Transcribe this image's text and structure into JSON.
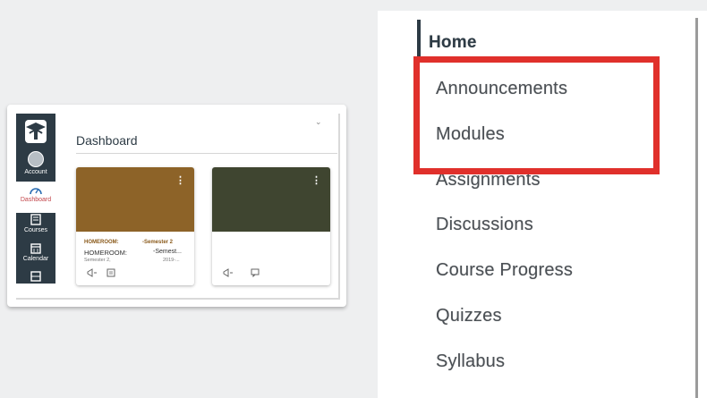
{
  "dashboard": {
    "title": "Dashboard",
    "global_nav": [
      {
        "label": "Account",
        "icon": "account-avatar-icon"
      },
      {
        "label": "Dashboard",
        "icon": "dashboard-speedometer-icon",
        "active": true
      },
      {
        "label": "Courses",
        "icon": "courses-book-icon"
      },
      {
        "label": "Calendar",
        "icon": "calendar-icon"
      },
      {
        "label": "",
        "icon": "inbox-icon"
      }
    ],
    "cards": [
      {
        "color": "#8d6328",
        "code": "HOMEROOM:",
        "term": "-Semester 2",
        "name": "HOMEROOM:",
        "name_right": "-Semest...",
        "sub": "Semester 2,",
        "sub_right": "2019-..."
      },
      {
        "color": "#3f4530",
        "code": "",
        "term": "",
        "name": "",
        "name_right": "",
        "sub": "",
        "sub_right": ""
      }
    ]
  },
  "course_nav": {
    "items": [
      {
        "label": "Home",
        "active": true
      },
      {
        "label": "Announcements"
      },
      {
        "label": "Modules"
      },
      {
        "label": "Assignments"
      },
      {
        "label": "Discussions"
      },
      {
        "label": "Course Progress"
      },
      {
        "label": "Quizzes"
      },
      {
        "label": "Syllabus"
      }
    ],
    "highlight_color": "#e0302b"
  },
  "colors": {
    "global_nav_bg": "#2d3b45",
    "active_nav_text": "#c2464b"
  }
}
